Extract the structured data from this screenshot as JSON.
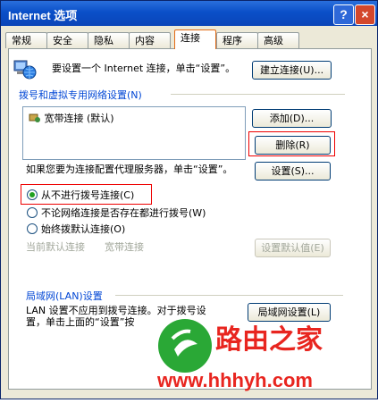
{
  "window": {
    "title": "Internet 选项",
    "help": "?",
    "close": "×"
  },
  "tabs": [
    "常规",
    "安全",
    "隐私",
    "内容",
    "连接",
    "程序",
    "高级"
  ],
  "setup": {
    "text": "要设置一个 Internet 连接，单击“设置”。",
    "button": "建立连接(U)..."
  },
  "dialup": {
    "group_label": "拨号和虚拟专用网络设置(N)",
    "items": [
      "宽带连接 (默认)"
    ],
    "add": "添加(D)...",
    "remove": "删除(R)",
    "proxy_text": "如果您要为连接配置代理服务器，单击“设置”。",
    "settings": "设置(S)..."
  },
  "radios": [
    {
      "label": "从不进行拨号连接(C)",
      "checked": true
    },
    {
      "label": "不论网络连接是否存在都进行拨号(W)",
      "checked": false
    },
    {
      "label": "始终拨默认连接(O)",
      "checked": false
    }
  ],
  "default_conn": {
    "label": "当前默认连接",
    "value": "宽带连接",
    "button": "设置默认值(E)"
  },
  "lan": {
    "group_label": "局域网(LAN)设置",
    "text_line1": "LAN 设置不应用到拨号连接。对于拨号设",
    "text_line2": "置，单击上面的“设置”按",
    "button": "局域网设置(L)"
  },
  "watermark": {
    "brand": "路由之家",
    "url": "www.hhhyh.com"
  },
  "colors": {
    "title_bar": "#0a4fc8",
    "highlight_red": "#ee0000",
    "watermark_green": "#2aa836",
    "watermark_red": "#e8251f"
  }
}
